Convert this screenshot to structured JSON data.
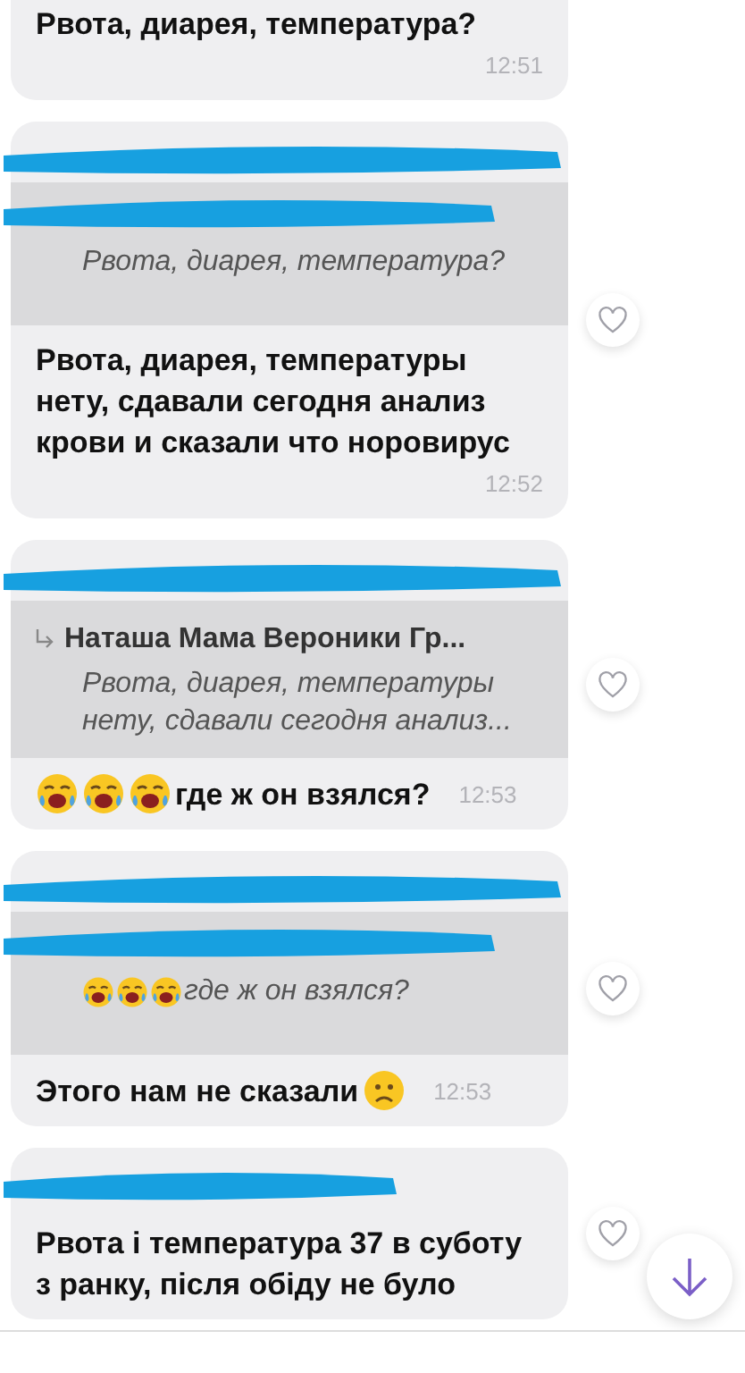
{
  "messages": [
    {
      "redacted_sender": false,
      "body": [
        {
          "kind": "text",
          "text": "Рвота, диарея, температура?"
        }
      ],
      "time": "12:51",
      "heart": false
    },
    {
      "redacted_sender": true,
      "quote": {
        "sender_redacted": true,
        "body": [
          {
            "kind": "text",
            "text": "Рвота, диарея, температура?"
          }
        ]
      },
      "body": [
        {
          "kind": "text",
          "text": "Рвота, диарея, температуры нету, сдавали сегодня анализ крови и сказали что норовирус"
        }
      ],
      "time": "12:52",
      "heart": true
    },
    {
      "redacted_sender": true,
      "quote": {
        "sender_redacted": false,
        "sender": "Наташа Мама Вероники  Гр...",
        "body": [
          {
            "kind": "text",
            "text": "Рвота, диарея, температуры нету, сдавали сегодня анализ..."
          }
        ]
      },
      "body": [
        {
          "kind": "crying"
        },
        {
          "kind": "crying"
        },
        {
          "kind": "crying"
        },
        {
          "kind": "text",
          "text": "где ж он взялся?"
        }
      ],
      "time": "12:53",
      "heart": true
    },
    {
      "redacted_sender": true,
      "quote": {
        "sender_redacted": true,
        "body": [
          {
            "kind": "crying"
          },
          {
            "kind": "crying"
          },
          {
            "kind": "crying"
          },
          {
            "kind": "text",
            "text": "где ж он взялся?"
          }
        ]
      },
      "body": [
        {
          "kind": "text",
          "text": "Этого нам не сказали"
        },
        {
          "kind": "sad"
        }
      ],
      "time": "12:53",
      "heart": true
    },
    {
      "redacted_sender": true,
      "body": [
        {
          "kind": "text",
          "text": "Рвота і температура 37 в суботу з ранку, після обіду не було"
        }
      ],
      "heart": true
    }
  ],
  "scroll_down_button": true
}
